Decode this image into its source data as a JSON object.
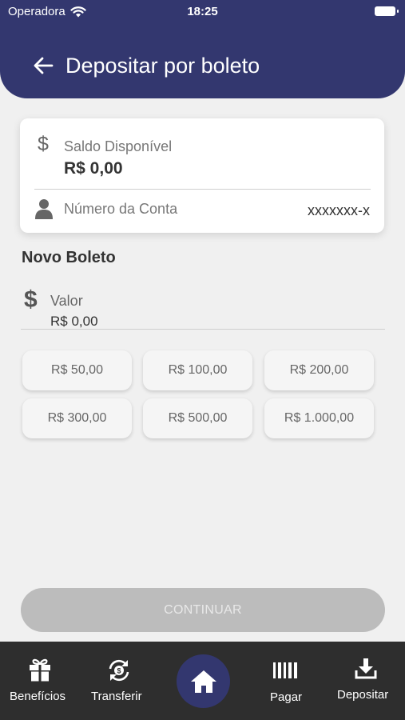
{
  "status_bar": {
    "carrier": "Operadora",
    "time": "18:25"
  },
  "header": {
    "title": "Depositar por boleto"
  },
  "balance_card": {
    "balance_label": "Saldo Disponível",
    "balance_value": "R$ 0,00",
    "account_label": "Número da Conta",
    "account_value": "xxxxxxx-x"
  },
  "new_boleto": {
    "title": "Novo Boleto",
    "value_label": "Valor",
    "value_input": "R$ 0,00",
    "amount_options": [
      "R$ 50,00",
      "R$ 100,00",
      "R$ 200,00",
      "R$ 300,00",
      "R$ 500,00",
      "R$ 1.000,00"
    ]
  },
  "continue_label": "CONTINUAR",
  "tabbar": {
    "items": [
      {
        "label": "Benefícios",
        "icon": "gift-icon"
      },
      {
        "label": "Transferir",
        "icon": "transfer-icon"
      },
      {
        "label": "",
        "icon": "home-icon"
      },
      {
        "label": "Pagar",
        "icon": "barcode-icon"
      },
      {
        "label": "Depositar",
        "icon": "download-icon"
      }
    ]
  },
  "colors": {
    "primary": "#33376f",
    "tabbar": "#2e2e2e",
    "background": "#f0f0f0",
    "disabled_button": "#bcbcbc"
  }
}
